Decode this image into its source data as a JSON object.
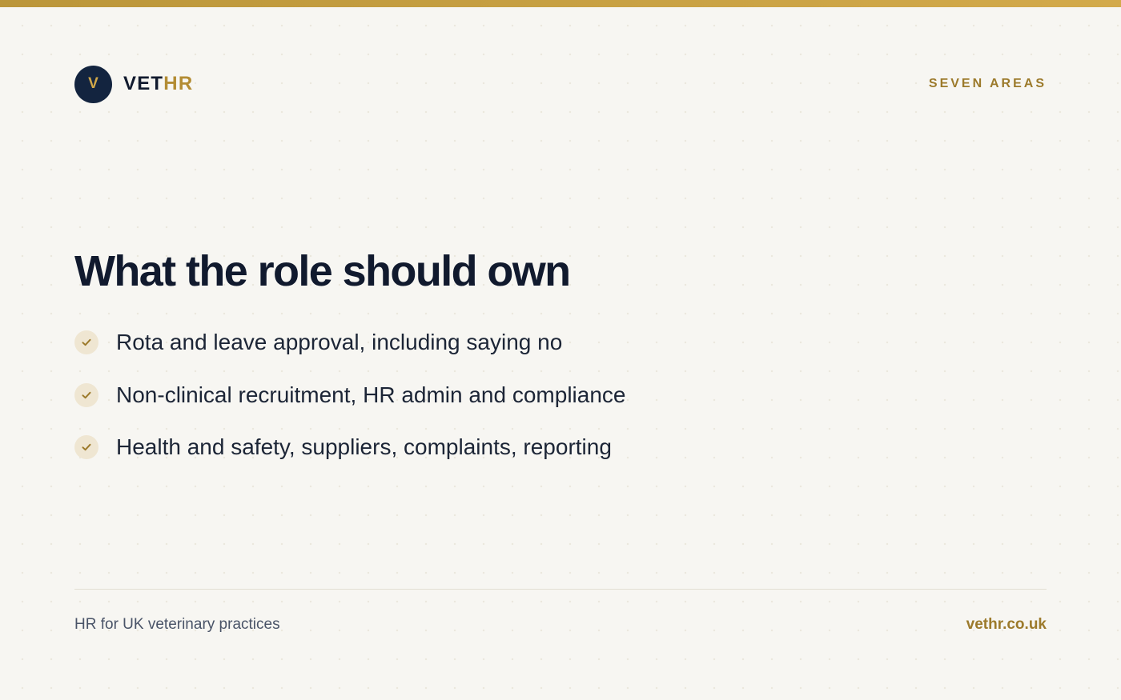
{
  "colors": {
    "accent_gold": "#b38c33",
    "navy": "#13243f",
    "background": "#f7f6f2",
    "check_bg": "#efe6d2"
  },
  "header": {
    "logo_letter": "V",
    "brand_primary": "VET",
    "brand_accent": "HR",
    "tagline": "SEVEN AREAS"
  },
  "main": {
    "title": "What the role should own",
    "items": [
      {
        "icon": "check-icon",
        "text": "Rota and leave approval, including saying no"
      },
      {
        "icon": "check-icon",
        "text": "Non-clinical recruitment, HR admin and compliance"
      },
      {
        "icon": "check-icon",
        "text": "Health and safety, suppliers, complaints, reporting"
      }
    ]
  },
  "footer": {
    "left_text": "HR for UK veterinary practices",
    "right_text": "vethr.co.uk"
  }
}
